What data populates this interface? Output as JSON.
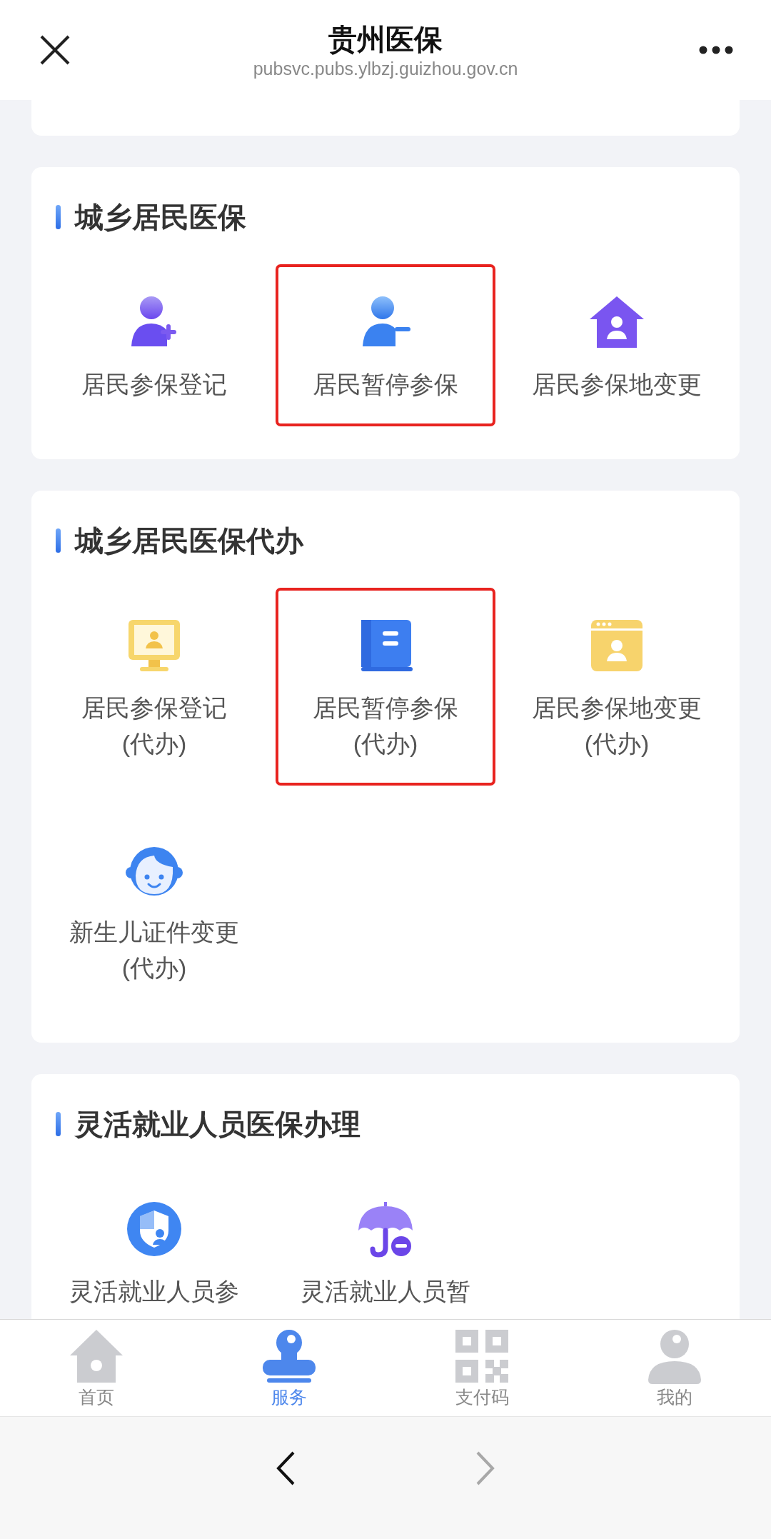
{
  "header": {
    "title": "贵州医保",
    "url": "pubsvc.pubs.ylbzj.guizhou.gov.cn"
  },
  "sections": [
    {
      "title": "城乡居民医保",
      "items": [
        {
          "label": [
            "居民参保登记"
          ],
          "highlighted": false
        },
        {
          "label": [
            "居民暂停参保"
          ],
          "highlighted": true
        },
        {
          "label": [
            "居民参保地变更"
          ],
          "highlighted": false
        }
      ]
    },
    {
      "title": "城乡居民医保代办",
      "items": [
        {
          "label": [
            "居民参保登记",
            "(代办)"
          ],
          "highlighted": false
        },
        {
          "label": [
            "居民暂停参保",
            "(代办)"
          ],
          "highlighted": true
        },
        {
          "label": [
            "居民参保地变更",
            "(代办)"
          ],
          "highlighted": false
        },
        {
          "label": [
            "新生儿证件变更",
            "(代办)"
          ],
          "highlighted": false
        }
      ]
    },
    {
      "title": "灵活就业人员医保办理",
      "items": [
        {
          "label": [
            "灵活就业人员参"
          ],
          "highlighted": false
        },
        {
          "label": [
            "灵活就业人员暂"
          ],
          "highlighted": false
        }
      ]
    }
  ],
  "tab_bar": [
    {
      "label": "首页",
      "selected": false
    },
    {
      "label": "服务",
      "selected": true
    },
    {
      "label": "支付码",
      "selected": false
    },
    {
      "label": "我的",
      "selected": false
    }
  ],
  "browser_nav": {
    "back_disabled": false,
    "forward_disabled": true
  }
}
